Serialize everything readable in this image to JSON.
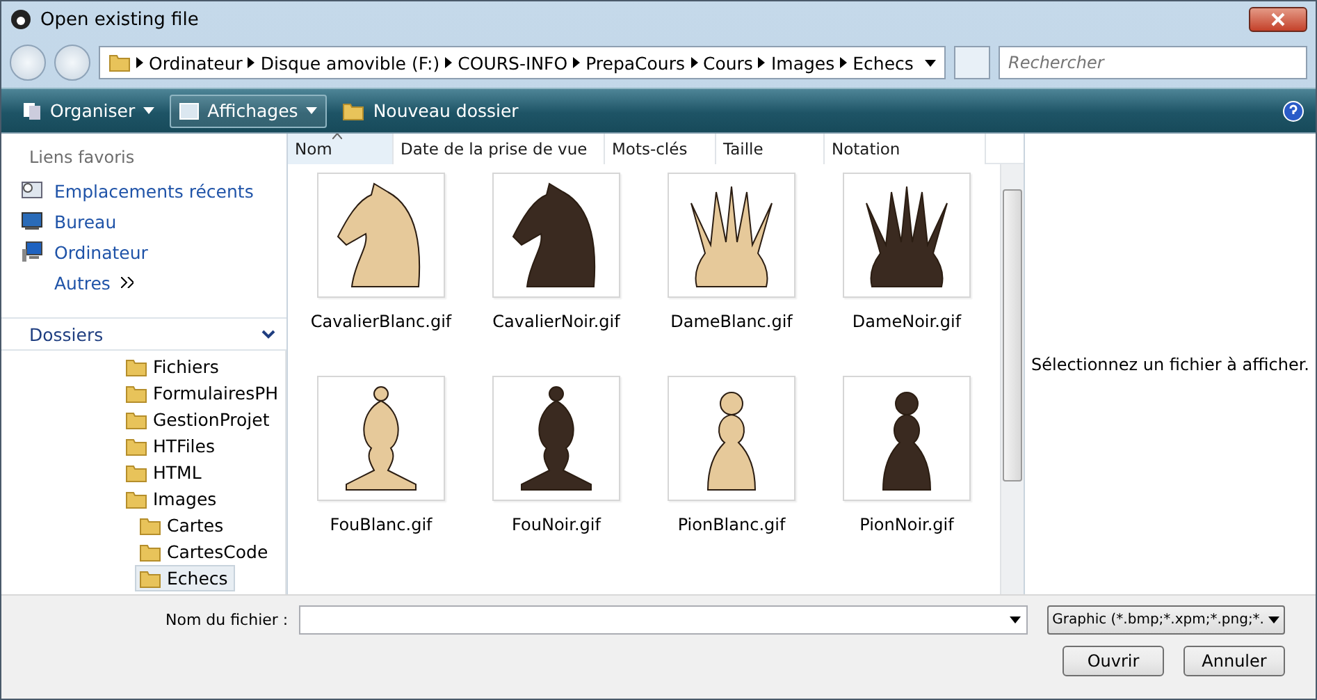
{
  "window": {
    "title": "Open existing file"
  },
  "breadcrumb": [
    "Ordinateur",
    "Disque amovible (F:)",
    "COURS-INFO",
    "PrepaCours",
    "Cours",
    "Images",
    "Echecs"
  ],
  "search": {
    "placeholder": "Rechercher"
  },
  "toolbar": [
    {
      "label": "Organiser",
      "kind": "menu"
    },
    {
      "label": "Affichages",
      "kind": "split"
    },
    {
      "label": "Nouveau dossier",
      "kind": "folder"
    }
  ],
  "favorites": {
    "title": "Liens favoris",
    "items": [
      {
        "label": "Emplacements récents",
        "kind": "recent"
      },
      {
        "label": "Bureau",
        "kind": "desktop"
      },
      {
        "label": "Ordinateur",
        "kind": "computer"
      },
      {
        "label": "Autres",
        "kind": "more"
      }
    ]
  },
  "folders": {
    "title": "Dossiers",
    "expanded": true,
    "items": [
      {
        "label": "Fichiers",
        "selected": false
      },
      {
        "label": "FormulairesPH",
        "selected": false
      },
      {
        "label": "GestionProjet",
        "selected": false
      },
      {
        "label": "HTFiles",
        "selected": false
      },
      {
        "label": "HTML",
        "selected": false
      },
      {
        "label": "Images",
        "selected": false,
        "children": [
          {
            "label": "Cartes",
            "selected": false
          },
          {
            "label": "CartesCode",
            "selected": false
          },
          {
            "label": "Echecs",
            "selected": true
          }
        ]
      }
    ]
  },
  "columns": [
    {
      "label": "Nom",
      "sorted": true
    },
    {
      "label": "Date de la prise de vue",
      "sorted": false
    },
    {
      "label": "Mots-clés",
      "sorted": false
    },
    {
      "label": "Taille",
      "sorted": false
    },
    {
      "label": "Notation",
      "sorted": false
    }
  ],
  "files": [
    {
      "name": "CavalierBlanc.gif",
      "kind": "knight",
      "color": "#e6c99a"
    },
    {
      "name": "CavalierNoir.gif",
      "kind": "knight",
      "color": "#3a2a20"
    },
    {
      "name": "DameBlanc.gif",
      "kind": "queen",
      "color": "#e6c99a"
    },
    {
      "name": "DameNoir.gif",
      "kind": "queen",
      "color": "#3a2a20"
    },
    {
      "name": "FouBlanc.gif",
      "kind": "bishop",
      "color": "#e6c99a"
    },
    {
      "name": "FouNoir.gif",
      "kind": "bishop",
      "color": "#3a2a20"
    },
    {
      "name": "PionBlanc.gif",
      "kind": "pawn",
      "color": "#e6c99a"
    },
    {
      "name": "PionNoir.gif",
      "kind": "pawn",
      "color": "#3a2a20"
    }
  ],
  "preview": {
    "message": "Sélectionnez un fichier à afficher."
  },
  "filename": {
    "label": "Nom du fichier :"
  },
  "filter": {
    "value": "Graphic (*.bmp;*.xpm;*.png;*."
  },
  "buttons": [
    "Ouvrir",
    "Annuler"
  ]
}
